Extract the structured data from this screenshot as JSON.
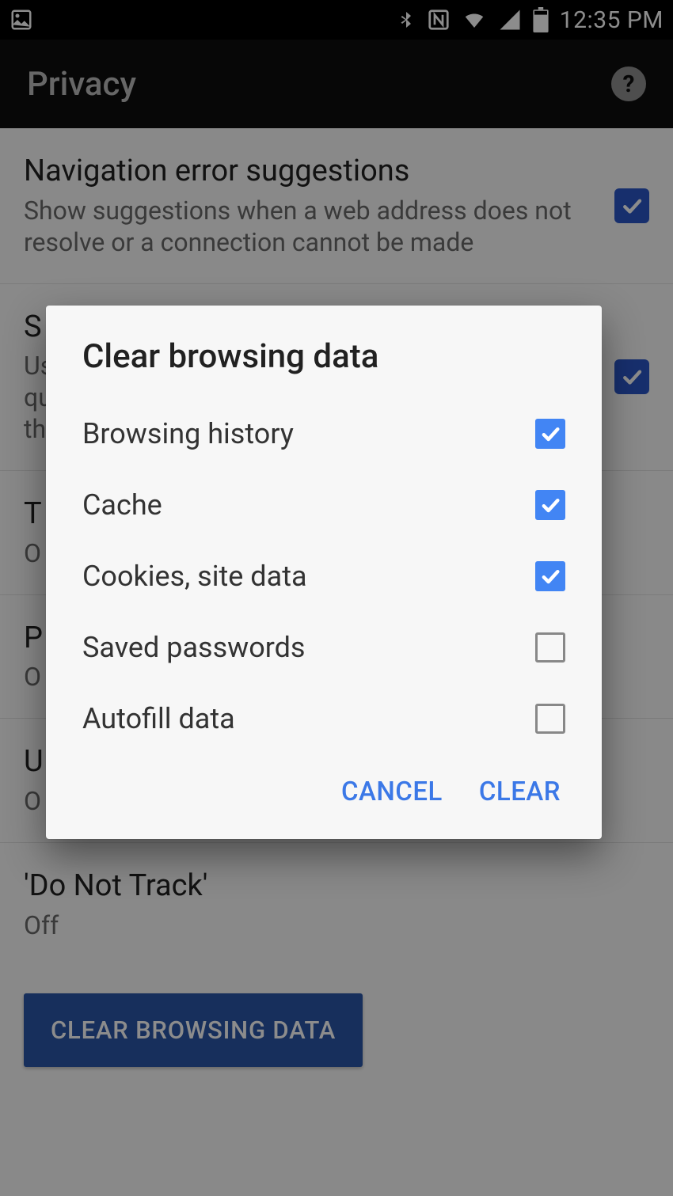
{
  "statusbar": {
    "time": "12:35 PM"
  },
  "appbar": {
    "title": "Privacy",
    "help_glyph": "?"
  },
  "settings": {
    "items": [
      {
        "title": "Navigation error suggestions",
        "sub": "Show suggestions when a web address does not resolve or a connection cannot be made",
        "checked": true
      },
      {
        "title": "S",
        "sub": "Us\nqu\nth",
        "checked": true
      },
      {
        "title": "T",
        "sub": "O",
        "checked": false
      },
      {
        "title": "P",
        "sub": "O",
        "checked": false
      },
      {
        "title": "U",
        "sub": "O",
        "checked": false
      },
      {
        "title": "'Do Not Track'",
        "sub": "Off",
        "checked": false
      }
    ],
    "clear_button": "CLEAR BROWSING DATA"
  },
  "dialog": {
    "title": "Clear browsing data",
    "options": [
      {
        "label": "Browsing history",
        "checked": true
      },
      {
        "label": "Cache",
        "checked": true
      },
      {
        "label": "Cookies, site data",
        "checked": true
      },
      {
        "label": "Saved passwords",
        "checked": false
      },
      {
        "label": "Autofill data",
        "checked": false
      }
    ],
    "cancel": "CANCEL",
    "clear": "CLEAR"
  }
}
